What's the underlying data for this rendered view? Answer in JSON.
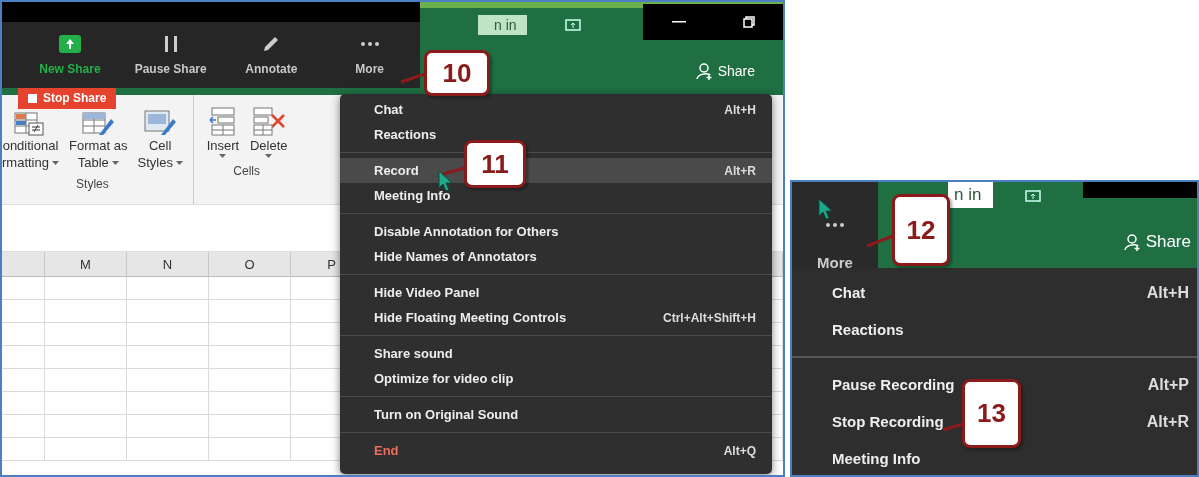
{
  "screen_1": {
    "toolbar": [
      {
        "kind": "share",
        "label": "New Share"
      },
      {
        "kind": "pause",
        "label": "Pause Share"
      },
      {
        "kind": "pencil",
        "label": "Annotate"
      },
      {
        "kind": "more",
        "label": "More"
      }
    ],
    "stop_share": "Stop Share",
    "sign_in": "n in",
    "share": "Share",
    "ribbon_groups": [
      {
        "label": "Styles",
        "buttons": [
          {
            "kind": "conditional",
            "lines": [
              "onditional",
              "rmatting"
            ],
            "dropdown": true
          },
          {
            "kind": "table",
            "lines": [
              "Format as",
              "Table"
            ],
            "dropdown": true
          },
          {
            "kind": "styles",
            "lines": [
              "Cell",
              "Styles"
            ],
            "dropdown": true
          }
        ]
      },
      {
        "label": "Cells",
        "buttons": [
          {
            "kind": "insert",
            "lines": [
              "Insert"
            ],
            "dropdown": true
          },
          {
            "kind": "delete",
            "lines": [
              "Delete"
            ],
            "dropdown": true
          }
        ]
      }
    ],
    "columns": [
      "M",
      "N",
      "O",
      "P"
    ],
    "menu": [
      [
        {
          "label": "Chat",
          "shortcut": "Alt+H",
          "selected": false,
          "kind": "normal"
        },
        {
          "label": "Reactions",
          "selected": false,
          "kind": "normal"
        }
      ],
      [
        {
          "label": "Record",
          "shortcut": "Alt+R",
          "selected": true,
          "kind": "normal"
        },
        {
          "label": "Meeting Info",
          "selected": false,
          "kind": "normal"
        }
      ],
      [
        {
          "label": "Disable Annotation for Others",
          "selected": false,
          "kind": "normal"
        },
        {
          "label": "Hide Names of Annotators",
          "selected": false,
          "kind": "normal"
        }
      ],
      [
        {
          "label": "Hide Video Panel",
          "selected": false,
          "kind": "normal"
        },
        {
          "label": "Hide Floating Meeting Controls",
          "shortcut": "Ctrl+Alt+Shift+H",
          "selected": false,
          "kind": "normal"
        }
      ],
      [
        {
          "label": "Share sound",
          "selected": false,
          "kind": "normal"
        },
        {
          "label": "Optimize for video clip",
          "selected": false,
          "kind": "normal"
        }
      ],
      [
        {
          "label": "Turn on Original Sound",
          "selected": false,
          "kind": "normal"
        }
      ],
      [
        {
          "label": "End",
          "shortcut": "Alt+Q",
          "selected": false,
          "kind": "danger"
        }
      ]
    ],
    "callouts": [
      "10",
      "11"
    ]
  },
  "screen_2": {
    "more": "More",
    "sign_in": "n in",
    "share": "Share",
    "menu": [
      [
        {
          "label": "Chat",
          "shortcut": "Alt+H"
        },
        {
          "label": "Reactions"
        }
      ],
      [
        {
          "label": "Pause Recording",
          "shortcut": "Alt+P"
        },
        {
          "label": "Stop Recording",
          "shortcut": "Alt+R"
        },
        {
          "label": "Meeting Info"
        }
      ]
    ],
    "callouts": [
      "12",
      "13"
    ]
  }
}
